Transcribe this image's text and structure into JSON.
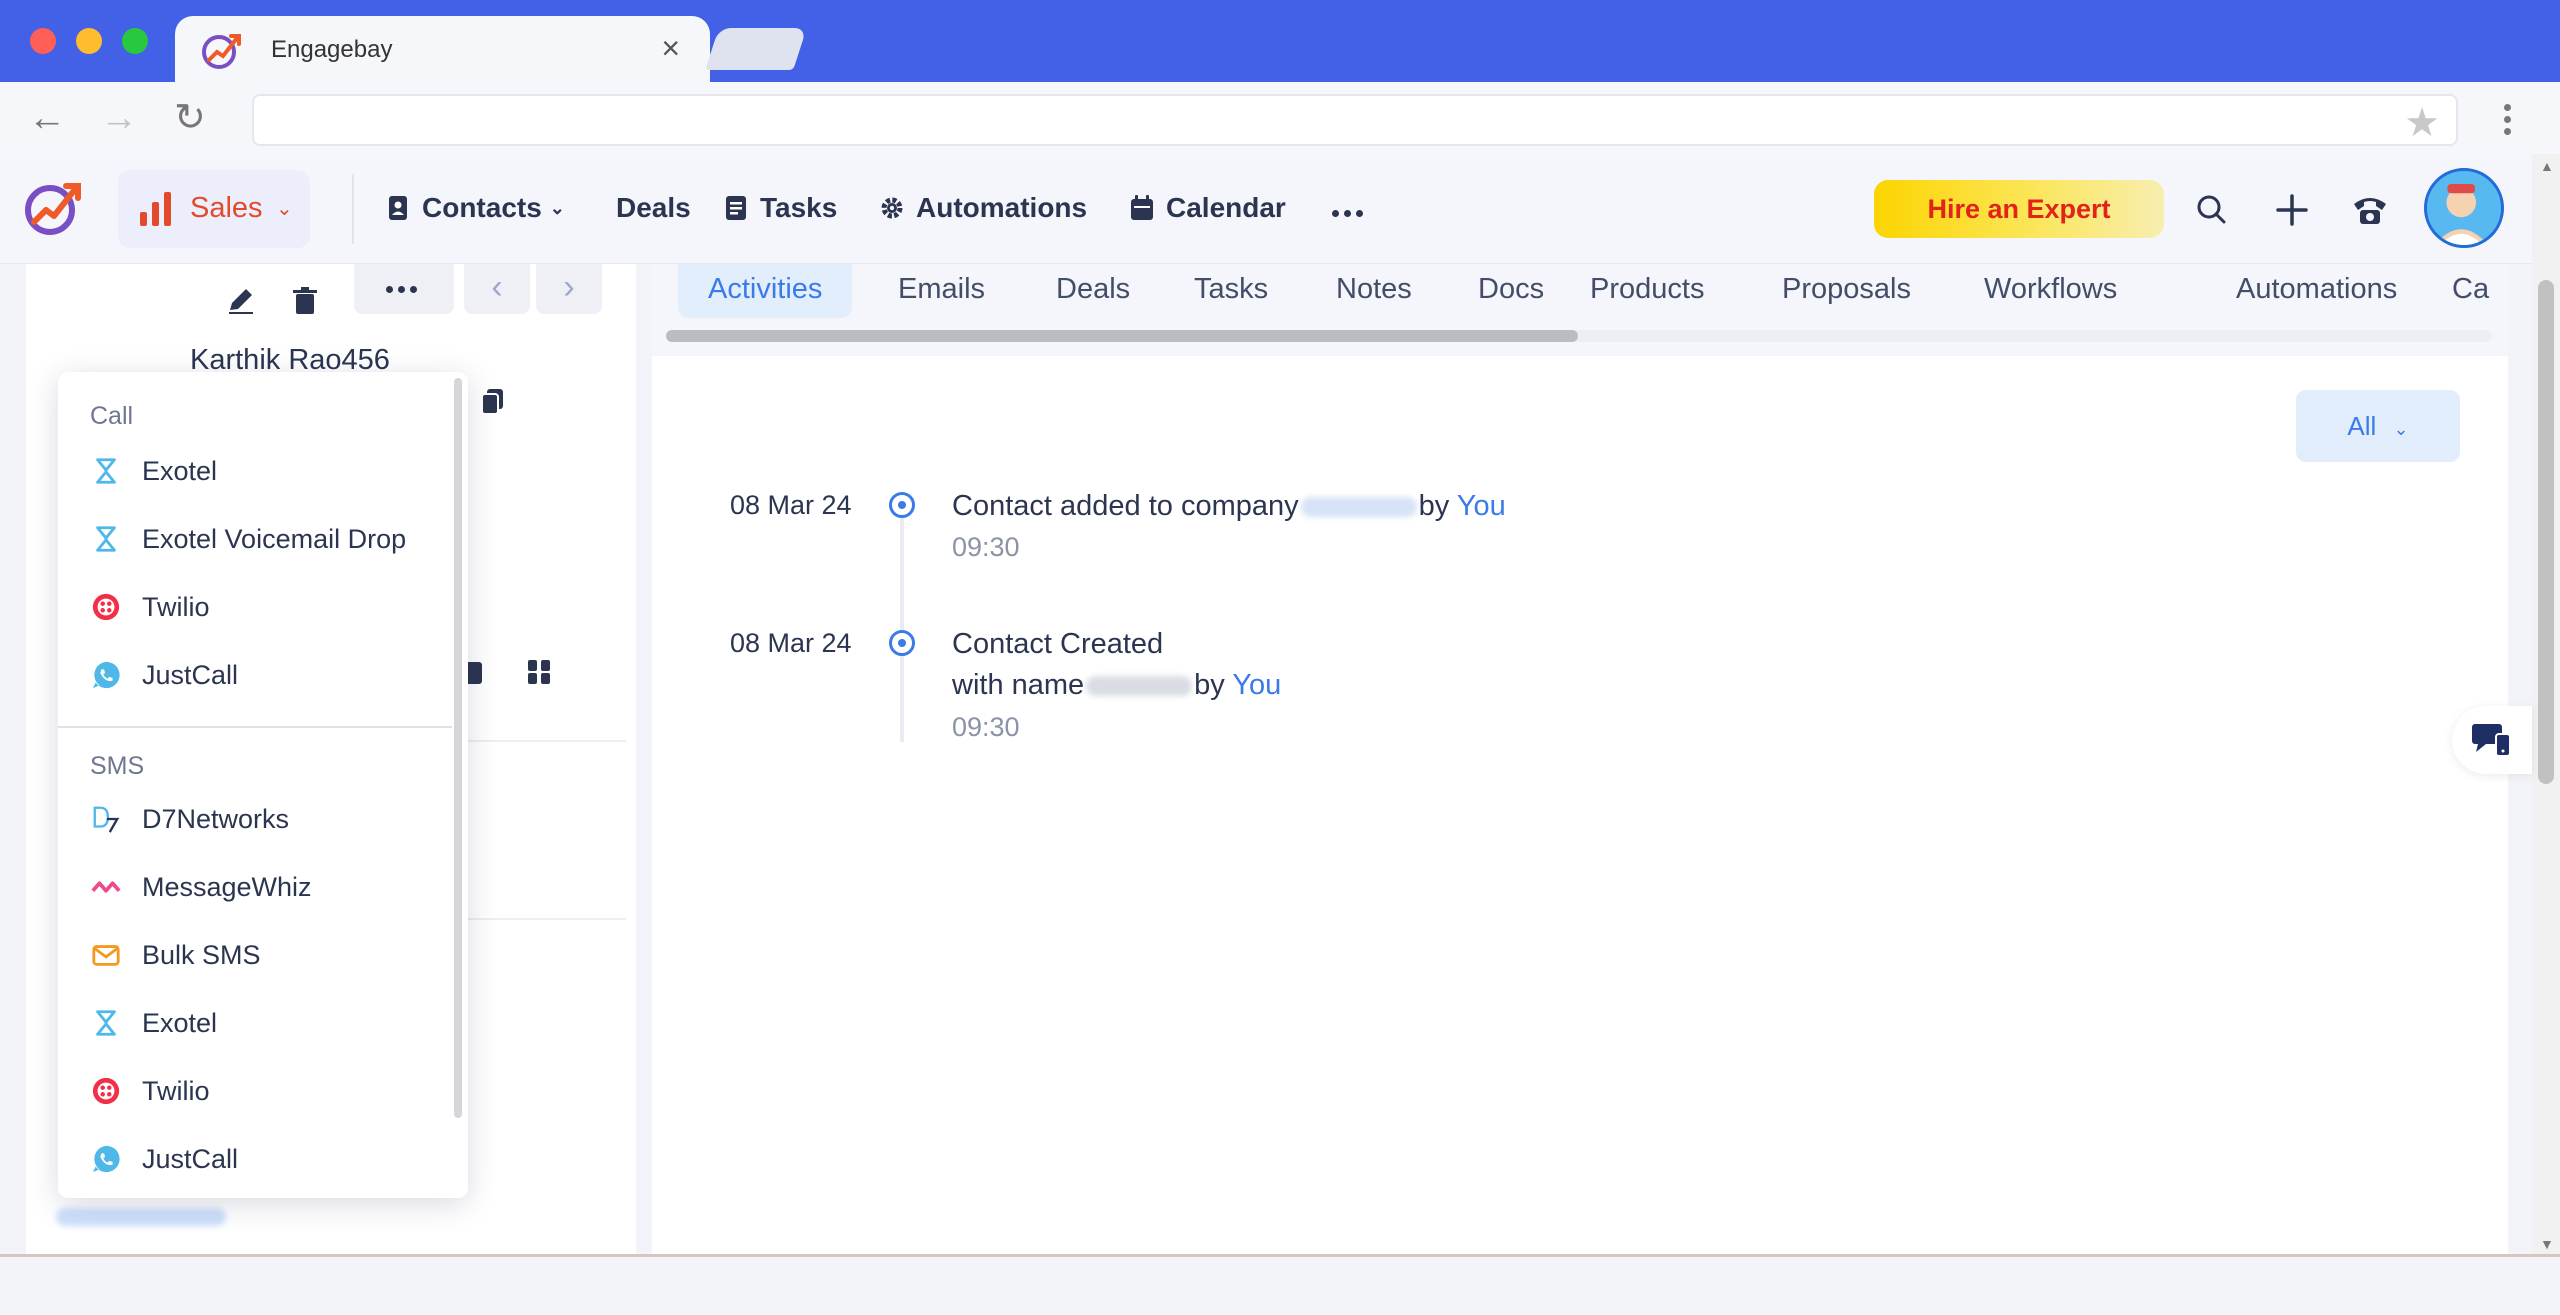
{
  "browser": {
    "tab_title": "Engagebay",
    "tab_close": "×",
    "address": "",
    "colors": {
      "chrome": "#4361e6",
      "close": "#ff5f57",
      "minimize": "#febc2e",
      "maximize": "#28c840"
    }
  },
  "header": {
    "module": "Sales",
    "nav": [
      {
        "label": "Contacts",
        "icon": "contact-book-icon",
        "has_dropdown": true
      },
      {
        "label": "Deals",
        "icon": ""
      },
      {
        "label": "Tasks",
        "icon": "task-list-icon"
      },
      {
        "label": "Automations",
        "icon": "gear-icon"
      },
      {
        "label": "Calendar",
        "icon": "calendar-icon"
      }
    ],
    "hire_expert": "Hire an Expert",
    "icons": [
      "search-icon",
      "plus-icon",
      "phone-icon",
      "avatar"
    ]
  },
  "contact": {
    "name": "Karthik Rao456"
  },
  "dropdown": {
    "sections": [
      {
        "title": "Call",
        "items": [
          {
            "label": "Exotel",
            "icon": "exotel-icon"
          },
          {
            "label": "Exotel Voicemail Drop",
            "icon": "exotel-icon"
          },
          {
            "label": "Twilio",
            "icon": "twilio-icon"
          },
          {
            "label": "JustCall",
            "icon": "justcall-icon"
          }
        ]
      },
      {
        "title": "SMS",
        "items": [
          {
            "label": "D7Networks",
            "icon": "d7networks-icon"
          },
          {
            "label": "MessageWhiz",
            "icon": "messagewhiz-icon"
          },
          {
            "label": "Bulk SMS",
            "icon": "envelope-icon"
          },
          {
            "label": "Exotel",
            "icon": "exotel-icon"
          },
          {
            "label": "Twilio",
            "icon": "twilio-icon"
          },
          {
            "label": "JustCall",
            "icon": "justcall-icon"
          }
        ]
      }
    ]
  },
  "tabs": [
    "Activities",
    "Emails",
    "Deals",
    "Tasks",
    "Notes",
    "Docs",
    "Products",
    "Proposals",
    "Workflows",
    "Automations",
    "Ca"
  ],
  "active_tab": "Activities",
  "filter": {
    "label": "All"
  },
  "timeline": [
    {
      "date": "08 Mar 24",
      "line1_prefix": "Contact added to company",
      "line1_suffix": "by",
      "actor": "You",
      "time": "09:30"
    },
    {
      "date": "08 Mar 24",
      "line1": "Contact Created",
      "line2_prefix": "with name",
      "line2_suffix": "by",
      "actor": "You",
      "time": "09:30"
    }
  ]
}
